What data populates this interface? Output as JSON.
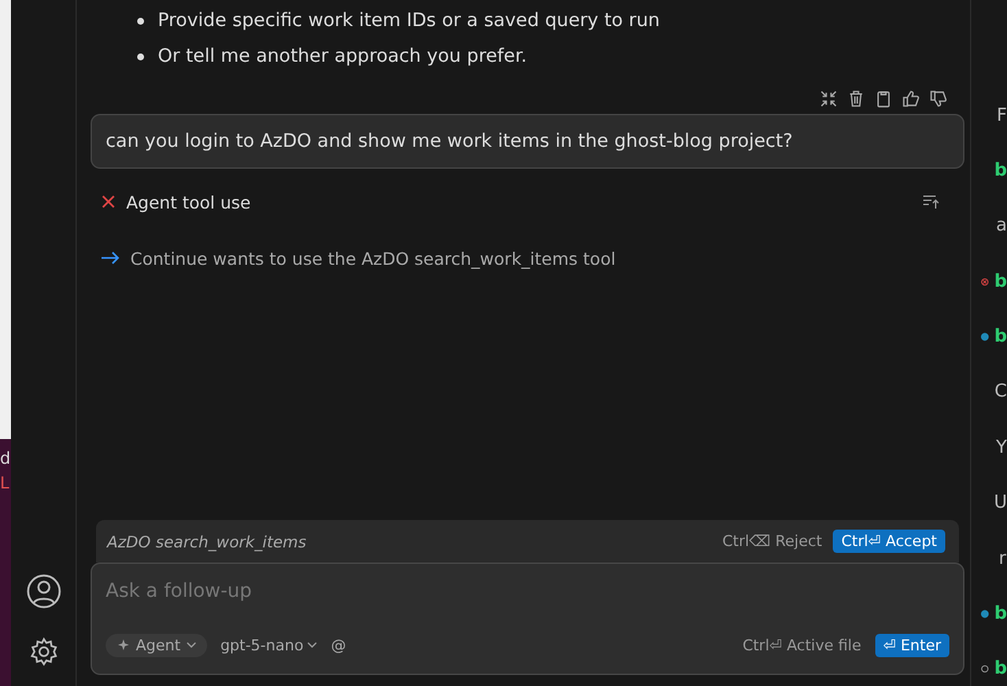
{
  "left_window": {
    "texts": [
      "d",
      "L"
    ]
  },
  "chat": {
    "bullets": [
      "Provide specific work item IDs or a saved query to run",
      "Or tell me another approach you prefer."
    ],
    "user_message": "can you login to AzDO and show me work items in the ghost-blog project?",
    "steps": [
      {
        "kind": "error",
        "label": "Agent tool use"
      },
      {
        "kind": "pending",
        "label": "Continue wants to use the AzDO search_work_items tool"
      }
    ],
    "tool_call": {
      "name": "AzDO search_work_items",
      "reject": "Ctrl⌫ Reject",
      "accept": "Ctrl⏎ Accept"
    },
    "input": {
      "placeholder": "Ask a follow-up",
      "mode": "Agent",
      "model": "gpt-5-nano",
      "mention": "@",
      "active_file": "Ctrl⏎ Active file",
      "send": "⏎ Enter"
    }
  },
  "right_panel": {
    "lines": [
      {
        "text": "F",
        "kind": "plain",
        "green": false
      },
      {
        "text": "b",
        "kind": "plain",
        "green": true
      },
      {
        "text": "a",
        "kind": "plain",
        "green": false
      },
      {
        "text": "b",
        "kind": "error",
        "green": true
      },
      {
        "text": "b",
        "kind": "info",
        "green": true
      },
      {
        "text": "C",
        "kind": "plain",
        "green": false
      },
      {
        "text": "Y",
        "kind": "plain",
        "green": false
      },
      {
        "text": "U",
        "kind": "plain",
        "green": false
      },
      {
        "text": "r",
        "kind": "plain",
        "green": false
      },
      {
        "text": "b",
        "kind": "info",
        "green": true
      },
      {
        "text": "b",
        "kind": "ring",
        "green": true
      }
    ]
  }
}
